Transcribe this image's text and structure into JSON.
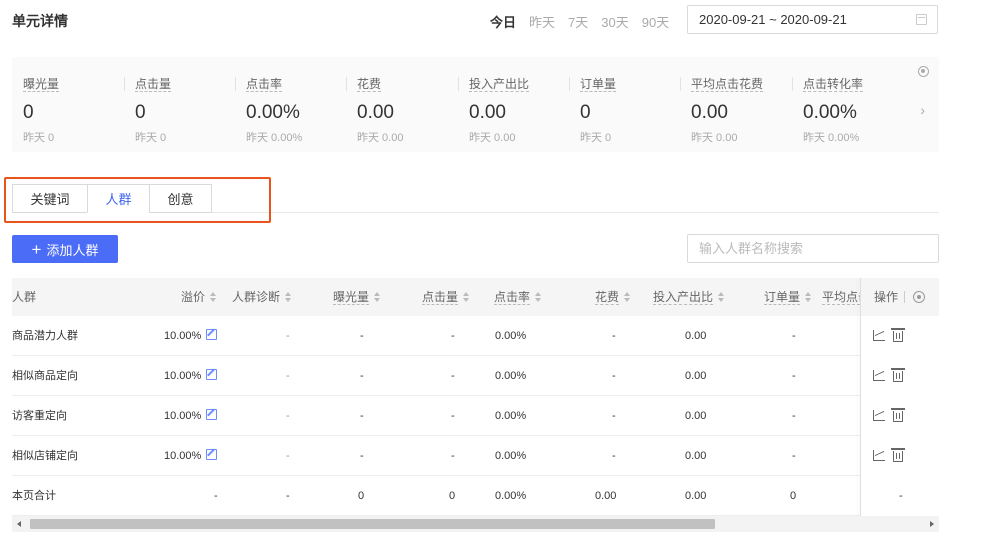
{
  "header": {
    "title": "单元详情",
    "quick_dates": [
      "今日",
      "昨天",
      "7天",
      "30天",
      "90天"
    ],
    "active_quick_date": "今日",
    "date_range": "2020-09-21 ~ 2020-09-21"
  },
  "metrics": [
    {
      "label": "曝光量",
      "value": "0",
      "prev": "昨天 0"
    },
    {
      "label": "点击量",
      "value": "0",
      "prev": "昨天 0"
    },
    {
      "label": "点击率",
      "value": "0.00%",
      "prev": "昨天 0.00%"
    },
    {
      "label": "花费",
      "value": "0.00",
      "prev": "昨天 0.00"
    },
    {
      "label": "投入产出比",
      "value": "0.00",
      "prev": "昨天 0.00"
    },
    {
      "label": "订单量",
      "value": "0",
      "prev": "昨天 0"
    },
    {
      "label": "平均点击花费",
      "value": "0.00",
      "prev": "昨天 0.00"
    },
    {
      "label": "点击转化率",
      "value": "0.00%",
      "prev": "昨天 0.00%"
    }
  ],
  "tabs": [
    {
      "label": "关键词",
      "active": false
    },
    {
      "label": "人群",
      "active": true
    },
    {
      "label": "创意",
      "active": false
    }
  ],
  "toolbar": {
    "add_label": "添加人群",
    "search_placeholder": "输入人群名称搜索"
  },
  "table": {
    "headers": [
      "人群",
      "溢价",
      "人群诊断",
      "曝光量",
      "点击量",
      "点击率",
      "花费",
      "投入产出比",
      "订单量",
      "平均点击",
      "操作"
    ],
    "rows": [
      {
        "name": "商品潜力人群",
        "premium": "10.00%",
        "diag": "-",
        "impr": "-",
        "clicks": "-",
        "ctr": "0.00%",
        "cost": "-",
        "roi": "0.00",
        "orders": "-"
      },
      {
        "name": "相似商品定向",
        "premium": "10.00%",
        "diag": "-",
        "impr": "-",
        "clicks": "-",
        "ctr": "0.00%",
        "cost": "-",
        "roi": "0.00",
        "orders": "-"
      },
      {
        "name": "访客重定向",
        "premium": "10.00%",
        "diag": "-",
        "impr": "-",
        "clicks": "-",
        "ctr": "0.00%",
        "cost": "-",
        "roi": "0.00",
        "orders": "-"
      },
      {
        "name": "相似店铺定向",
        "premium": "10.00%",
        "diag": "-",
        "impr": "-",
        "clicks": "-",
        "ctr": "0.00%",
        "cost": "-",
        "roi": "0.00",
        "orders": "-"
      }
    ],
    "total": {
      "name": "本页合计",
      "premium": "-",
      "diag": "-",
      "impr": "0",
      "clicks": "0",
      "ctr": "0.00%",
      "cost": "0.00",
      "roi": "0.00",
      "orders": "0",
      "op": "-"
    }
  },
  "colors": {
    "accent": "#4a6cf7",
    "highlight_border": "#e8541c"
  }
}
